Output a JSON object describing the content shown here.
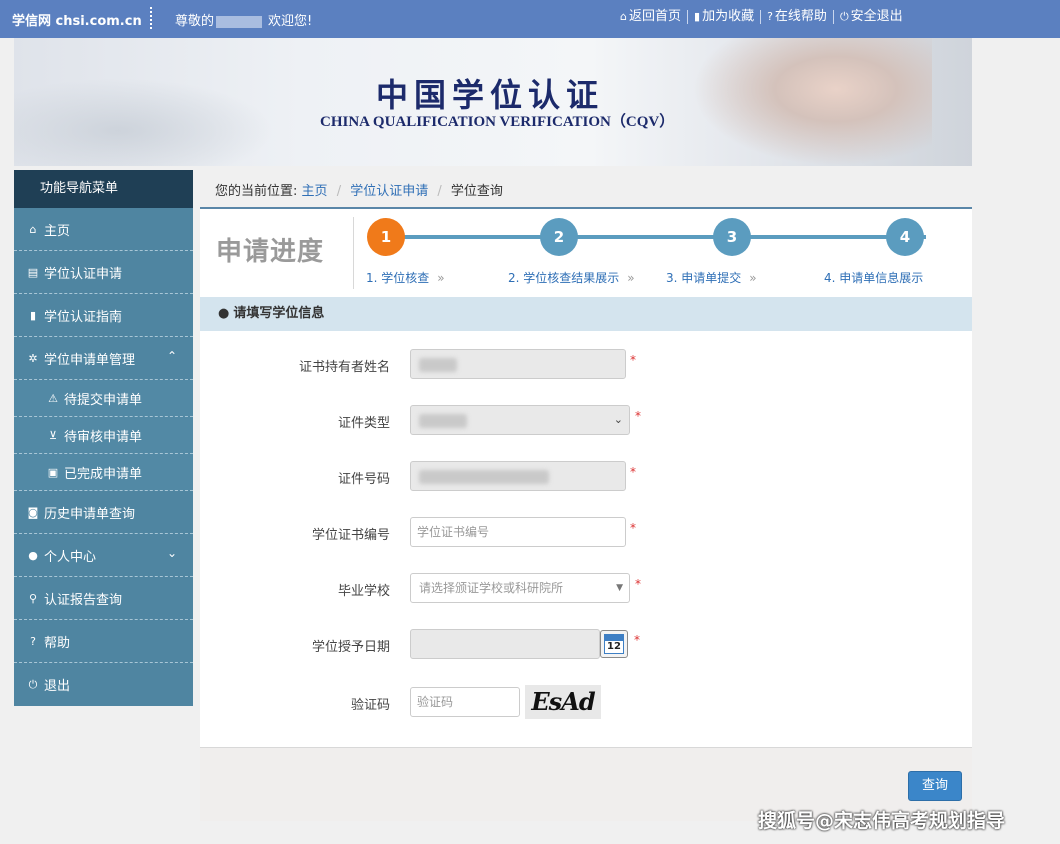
{
  "topbar": {
    "brand": "学信网 chsi.com.cn",
    "greeting_prefix": "尊敬的",
    "greeting_suffix": "欢迎您!",
    "nav": [
      {
        "icon": "home-icon",
        "glyph": "⌂",
        "label": "返回首页"
      },
      {
        "icon": "bookmark-icon",
        "glyph": "▮",
        "label": "加为收藏"
      },
      {
        "icon": "help-icon",
        "glyph": "?",
        "label": "在线帮助"
      },
      {
        "icon": "power-icon",
        "glyph": "⏻",
        "label": "安全退出"
      }
    ]
  },
  "banner": {
    "title": "中国学位认证",
    "subtitle": "CHINA QUALIFICATION VERIFICATION（CQV）"
  },
  "sidebar": {
    "header": "功能导航菜单",
    "items": [
      {
        "icon": "home-icon",
        "glyph": "⌂",
        "label": "主页"
      },
      {
        "icon": "file-icon",
        "glyph": "▤",
        "label": "学位认证申请"
      },
      {
        "icon": "bookmark-icon",
        "glyph": "▮",
        "label": "学位认证指南"
      },
      {
        "icon": "gear-icon",
        "glyph": "✲",
        "label": "学位申请单管理",
        "chevron": "⌃"
      },
      {
        "icon": "warning-icon",
        "glyph": "⚠",
        "label": "待提交申请单"
      },
      {
        "icon": "cart-icon",
        "glyph": "⊻",
        "label": "待审核申请单"
      },
      {
        "icon": "briefcase-icon",
        "glyph": "▣",
        "label": "已完成申请单"
      },
      {
        "icon": "camera-icon",
        "glyph": "◙",
        "label": "历史申请单查询"
      },
      {
        "icon": "user-icon",
        "glyph": "●",
        "label": "个人中心",
        "chevron": "⌄"
      },
      {
        "icon": "search-icon",
        "glyph": "⚲",
        "label": "认证报告查询"
      },
      {
        "icon": "help-icon",
        "glyph": "?",
        "label": "帮助"
      },
      {
        "icon": "power-icon",
        "glyph": "⏻",
        "label": "退出"
      }
    ]
  },
  "breadcrumb": {
    "prefix": "您的当前位置:",
    "items": [
      "主页",
      "学位认证申请",
      "学位查询"
    ],
    "divider": "/"
  },
  "progress": {
    "title": "申请进度",
    "steps": [
      {
        "num": "1",
        "label": "1. 学位核查",
        "active": true
      },
      {
        "num": "2",
        "label": "2. 学位核查结果展示",
        "active": false
      },
      {
        "num": "3",
        "label": "3. 申请单提交",
        "active": false
      },
      {
        "num": "4",
        "label": "4. 申请单信息展示",
        "active": false
      }
    ],
    "arrow": "»"
  },
  "form": {
    "section_title": "请填写学位信息",
    "required_mark": "*",
    "fields": {
      "name": {
        "label": "证书持有者姓名"
      },
      "id_type": {
        "label": "证件类型"
      },
      "id_number": {
        "label": "证件号码"
      },
      "cert_number": {
        "label": "学位证书编号",
        "placeholder": "学位证书编号"
      },
      "school": {
        "label": "毕业学校",
        "placeholder": "请选择颁证学校或科研院所"
      },
      "date": {
        "label": "学位授予日期",
        "calendar_day": "12"
      },
      "captcha": {
        "label": "验证码",
        "placeholder": "验证码",
        "image_text": "EsAd"
      }
    },
    "submit_label": "查询"
  },
  "watermark": "搜狐号@宋志伟高考规划指导"
}
